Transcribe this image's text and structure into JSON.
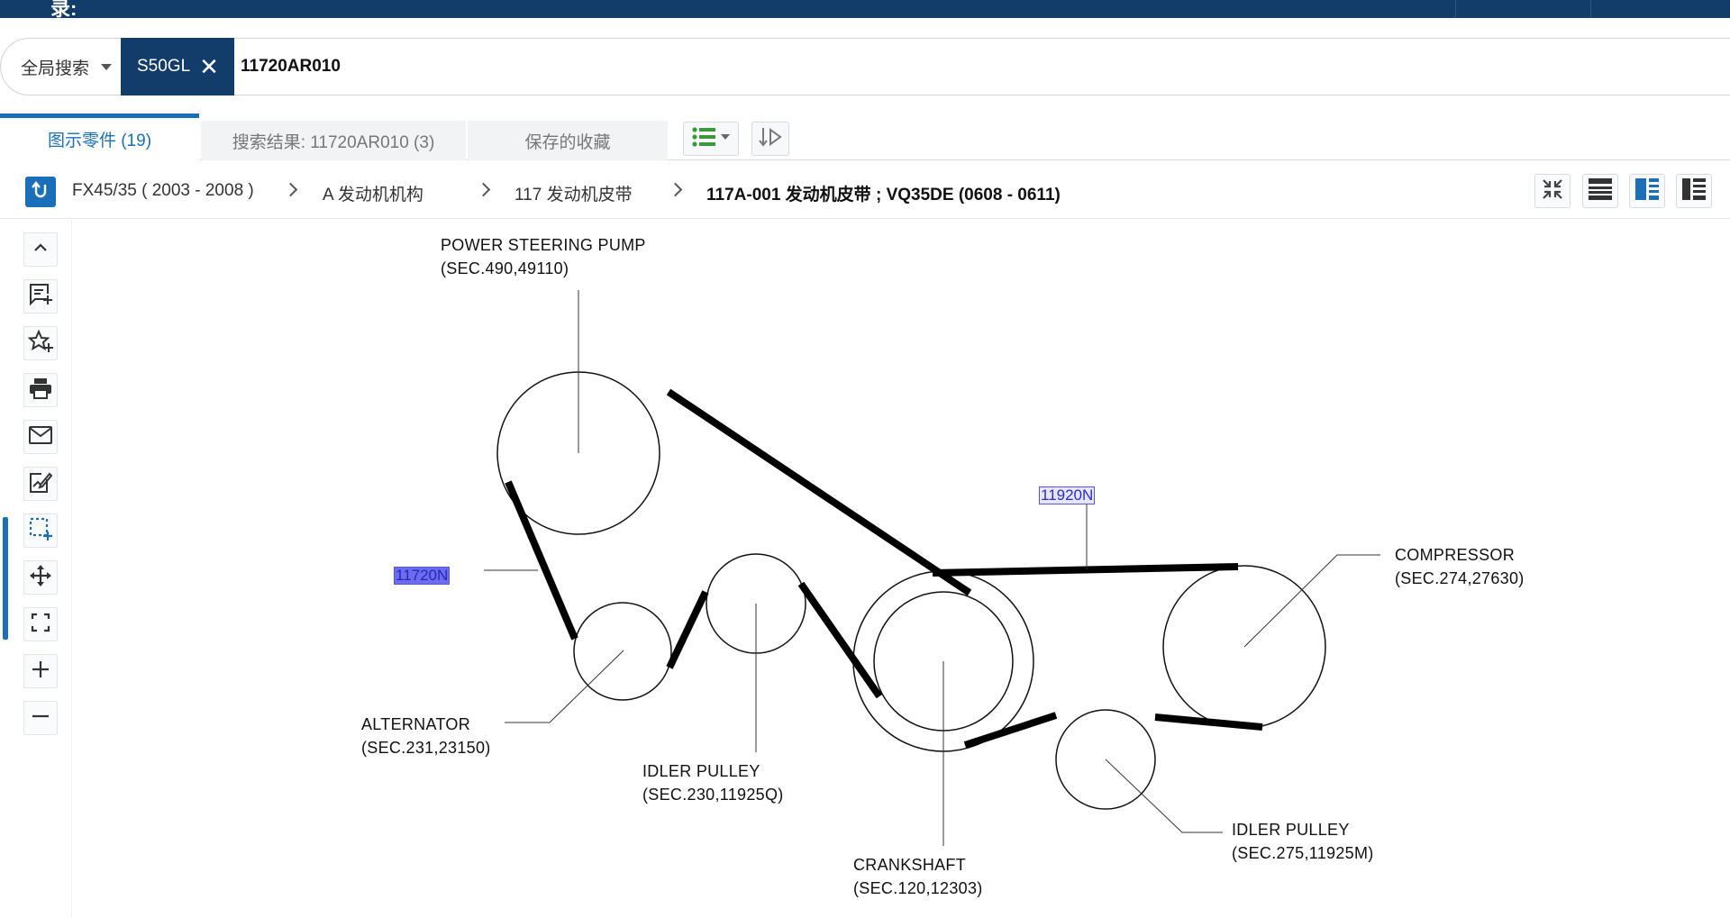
{
  "topbar": {
    "title": "录:"
  },
  "search": {
    "scope_label": "全局搜索",
    "vehicle_chip": "S50GL",
    "chip_close": "✕",
    "query": "11720AR010"
  },
  "tabs": [
    {
      "label": "图示零件 (19)",
      "active": true
    },
    {
      "label": "搜索结果: 11720AR010 (3)",
      "active": false
    },
    {
      "label": "保存的收藏",
      "active": false
    }
  ],
  "breadcrumb": [
    "FX45/35 ( 2003 - 2008 )",
    "A 发动机机构",
    "117 发动机皮带",
    "117A-001 发动机皮带 ; VQ35DE (0608 - 0611)"
  ],
  "diagram": {
    "labels": {
      "power_steering_name": "POWER  STEERING  PUMP",
      "power_steering_sec": "(SEC.490,49110)",
      "alternator_name": "ALTERNATOR",
      "alternator_sec": "(SEC.231,23150)",
      "idler1_name": "IDLER  PULLEY",
      "idler1_sec": "(SEC.230,11925Q)",
      "crankshaft_name": "CRANKSHAFT",
      "crankshaft_sec": "(SEC.120,12303)",
      "compressor_name": "COMPRESSOR",
      "compressor_sec": "(SEC.274,27630)",
      "idler2_name": "IDLER  PULLEY",
      "idler2_sec": "(SEC.275,11925M)"
    },
    "callouts": {
      "part_a": "11720N",
      "part_b": "11920N"
    }
  },
  "colors": {
    "brand_dark": "#123d6a",
    "accent": "#1a6fb8",
    "callout_highlight": "#6c6cf0"
  },
  "icons": {
    "left_toolbar": [
      "chevron-up-icon",
      "add-note-icon",
      "add-favorite-icon",
      "print-icon",
      "mail-icon",
      "edit-image-icon",
      "select-area-icon",
      "pan-icon",
      "fit-screen-icon",
      "zoom-in-icon",
      "zoom-out-icon"
    ],
    "view_modes": [
      "collapse-view-icon",
      "list-view-icon",
      "split-view-icon",
      "side-panel-view-icon"
    ]
  }
}
